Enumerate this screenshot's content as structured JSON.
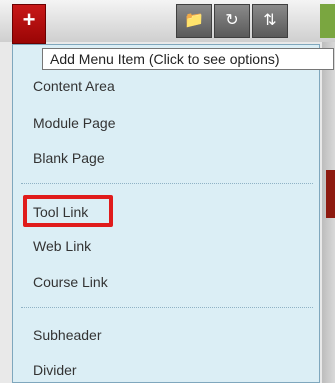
{
  "toolbar": {
    "add_label": "+",
    "icons": [
      "folder-icon",
      "refresh-icon",
      "sort-icon"
    ]
  },
  "tooltip": {
    "text": "Add Menu Item (Click to see options)"
  },
  "menu": {
    "items": [
      {
        "label": "Content Area"
      },
      {
        "label": "Module Page"
      },
      {
        "label": "Blank Page"
      },
      {
        "label": "Tool Link"
      },
      {
        "label": "Web Link"
      },
      {
        "label": "Course Link"
      },
      {
        "label": "Subheader"
      },
      {
        "label": "Divider"
      }
    ]
  },
  "colors": {
    "add_button": "#b20f0f",
    "menu_background": "#dbeef5",
    "highlight_border": "#e01b1b"
  }
}
